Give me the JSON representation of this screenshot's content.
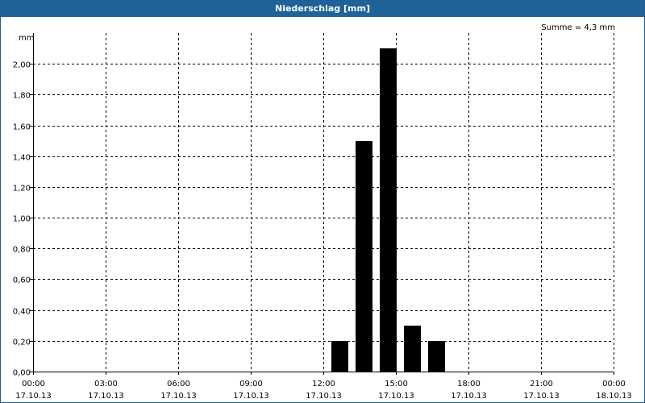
{
  "window": {
    "title": "Niederschlag [mm]"
  },
  "chart_data": {
    "type": "bar",
    "title": "Niederschlag [mm]",
    "ylabel": "mm",
    "annotation": "Summe = 4,3 mm",
    "ylim": [
      0,
      2.2
    ],
    "yticks": [
      0,
      0.2,
      0.4,
      0.6,
      0.8,
      1.0,
      1.2,
      1.4,
      1.6,
      1.8,
      2.0
    ],
    "ytick_labels": [
      "0,00",
      "0,20",
      "0,40",
      "0,60",
      "0,80",
      "1,00",
      "1,20",
      "1,40",
      "1,60",
      "1,80",
      "2,00"
    ],
    "xlim_hours": [
      0,
      24
    ],
    "xtick_hours": [
      0,
      3,
      6,
      9,
      12,
      15,
      18,
      21,
      24
    ],
    "xtick_labels": [
      [
        "00:00",
        "17.10.13"
      ],
      [
        "03:00",
        "17.10.13"
      ],
      [
        "06:00",
        "17.10.13"
      ],
      [
        "09:00",
        "17.10.13"
      ],
      [
        "12:00",
        "17.10.13"
      ],
      [
        "15:00",
        "17.10.13"
      ],
      [
        "18:00",
        "17.10.13"
      ],
      [
        "21:00",
        "17.10.13"
      ],
      [
        "00:00",
        "18.10.13"
      ]
    ],
    "bar_width_hours": 0.7,
    "bars": [
      {
        "hour": 12.33,
        "value": 0.2
      },
      {
        "hour": 13.33,
        "value": 1.5
      },
      {
        "hour": 14.33,
        "value": 2.1
      },
      {
        "hour": 15.33,
        "value": 0.3
      },
      {
        "hour": 16.33,
        "value": 0.2
      }
    ],
    "grid": true,
    "colors": {
      "bar": "#000000",
      "title_bar": "#1f6398",
      "grid": "#000000"
    }
  }
}
